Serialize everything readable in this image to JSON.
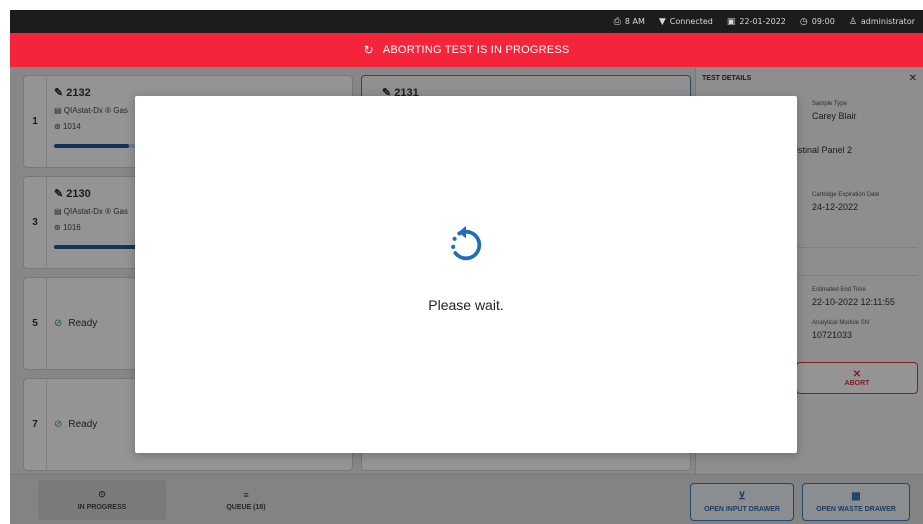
{
  "status_bar": {
    "printer_label": "8 AM",
    "connection_label": "Connected",
    "date": "22-01-2022",
    "time": "09:00",
    "user": "administrator"
  },
  "banner": {
    "text": "ABORTING TEST IS IN PROGRESS",
    "color": "#f4243a"
  },
  "slots_left": [
    {
      "number": "1",
      "test_id": "2132",
      "assay": "QIAstat-Dx ® Gas",
      "user_id": "1014",
      "progress": 0.25,
      "state": "running"
    },
    {
      "number": "3",
      "test_id": "2130",
      "assay": "QIAstat-Dx ® Gas",
      "user_id": "1016",
      "progress": 0.9,
      "state": "running"
    },
    {
      "number": "5",
      "status": "Ready",
      "state": "ready"
    },
    {
      "number": "7",
      "status": "Ready",
      "state": "ready"
    }
  ],
  "slot_right_active": {
    "test_id": "2131"
  },
  "details": {
    "header": "TEST DETAILS",
    "sample_type_label": "Sample Type",
    "sample_type_value": "Carey Blair",
    "assay_partial": "estinal Panel 2",
    "cartridge_exp_label": "Cartridge Expiration Date",
    "cartridge_exp_value": "24-12-2022",
    "end_time_label": "Estimated End Time",
    "end_time_value": "22-10-2022 12:11:55",
    "module_sn_label": "Analytical Module SN",
    "module_sn_value": "10721033",
    "abort_label": "ABORT"
  },
  "bottom": {
    "tab_in_progress": "IN PROGRESS",
    "tab_queue": "QUEUE (18)",
    "open_input_drawer": "OPEN INPUT DRAWER",
    "open_waste_drawer": "OPEN WASTE DRAWER"
  },
  "modal": {
    "message": "Please wait.",
    "spinner_color": "#1f6fb5"
  }
}
